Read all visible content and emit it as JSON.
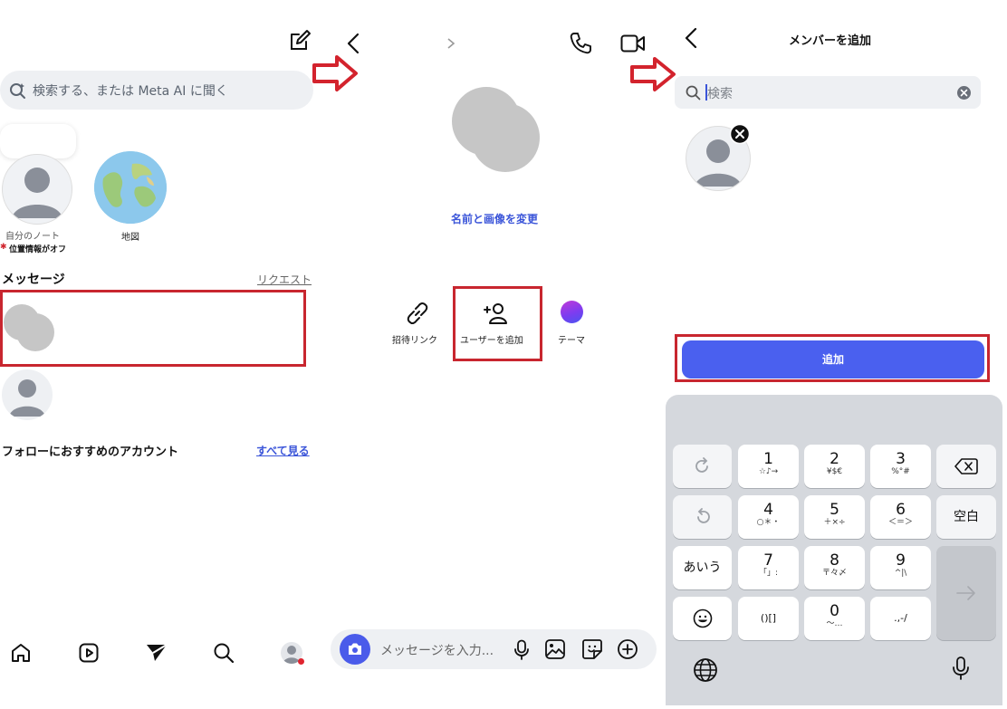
{
  "panel1": {
    "search_placeholder": "検索する、または Meta AI に聞く",
    "stories": [
      {
        "label": "自分のノート",
        "sublabel": "位置情報がオフ"
      },
      {
        "label": "地図"
      }
    ],
    "messages_title": "メッセージ",
    "requests_link": "リクエスト",
    "suggested_title": "フォローにおすすめのアカウント",
    "see_all_link": "すべて見る"
  },
  "panel2": {
    "change_name_photo": "名前と画像を変更",
    "actions": [
      {
        "label": "招待リンク",
        "icon": "link-icon"
      },
      {
        "label": "ユーザーを追加",
        "icon": "add-person-icon"
      },
      {
        "label": "テーマ",
        "icon": "theme-circle-icon"
      }
    ],
    "composer_placeholder": "メッセージを入力..."
  },
  "panel3": {
    "title": "メンバーを追加",
    "search_placeholder": "検索",
    "add_button": "追加",
    "keyboard": {
      "keys": [
        {
          "main": "1",
          "sub": "☆♪→"
        },
        {
          "main": "2",
          "sub": "¥$€"
        },
        {
          "main": "3",
          "sub": "%°#"
        },
        {
          "main": "4",
          "sub": "○＊・"
        },
        {
          "main": "5",
          "sub": "＋×÷"
        },
        {
          "main": "6",
          "sub": "＜＝＞"
        },
        {
          "main": "7",
          "sub": "「」:"
        },
        {
          "main": "8",
          "sub": "〒々〆"
        },
        {
          "main": "9",
          "sub": "^|\\"
        },
        {
          "main": "0",
          "sub": "〜…"
        }
      ],
      "bracket_key": "()[]",
      "punct_key": ".,-/",
      "hiragana_key": "あいう",
      "space_key": "空白"
    }
  },
  "colors": {
    "accent": "#4a60ef",
    "highlight_red": "#c8262f",
    "link_blue": "#3b55d9"
  }
}
